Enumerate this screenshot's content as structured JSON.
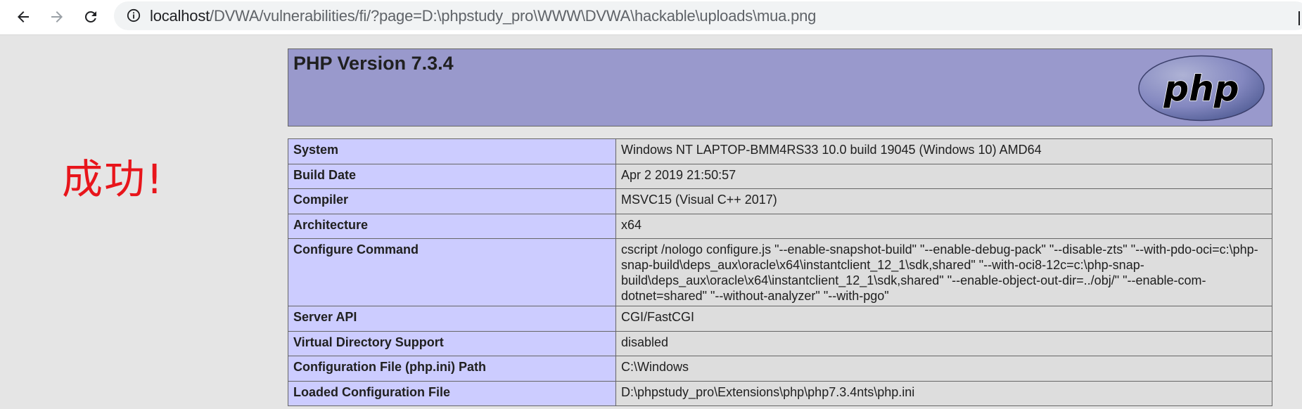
{
  "browser": {
    "url_host": "localhost",
    "url_path": "/DVWA/vulnerabilities/fi/?page=D:\\phpstudy_pro\\WWW\\DVWA\\hackable\\uploads\\mua.png",
    "icons": [
      "back-arrow-icon",
      "forward-arrow-icon",
      "reload-icon",
      "info-icon"
    ]
  },
  "annotation": {
    "success_text": "成功!",
    "color": "#e8151b"
  },
  "phpinfo": {
    "title": "PHP Version 7.3.4",
    "logo_text": "php",
    "colors": {
      "header_bg": "#9999cc",
      "key_bg": "#ccccff",
      "value_bg": "#dddddd"
    },
    "rows": [
      {
        "key": "System",
        "value": "Windows NT LAPTOP-BMM4RS33 10.0 build 19045 (Windows 10) AMD64"
      },
      {
        "key": "Build Date",
        "value": "Apr 2 2019 21:50:57"
      },
      {
        "key": "Compiler",
        "value": "MSVC15 (Visual C++ 2017)"
      },
      {
        "key": "Architecture",
        "value": "x64"
      },
      {
        "key": "Configure Command",
        "value": "cscript /nologo configure.js \"--enable-snapshot-build\" \"--enable-debug-pack\" \"--disable-zts\" \"--with-pdo-oci=c:\\php-snap-build\\deps_aux\\oracle\\x64\\instantclient_12_1\\sdk,shared\" \"--with-oci8-12c=c:\\php-snap-build\\deps_aux\\oracle\\x64\\instantclient_12_1\\sdk,shared\" \"--enable-object-out-dir=../obj/\" \"--enable-com-dotnet=shared\" \"--without-analyzer\" \"--with-pgo\""
      },
      {
        "key": "Server API",
        "value": "CGI/FastCGI"
      },
      {
        "key": "Virtual Directory Support",
        "value": "disabled"
      },
      {
        "key": "Configuration File (php.ini) Path",
        "value": "C:\\Windows"
      },
      {
        "key": "Loaded Configuration File",
        "value": "D:\\phpstudy_pro\\Extensions\\php\\php7.3.4nts\\php.ini"
      }
    ]
  }
}
